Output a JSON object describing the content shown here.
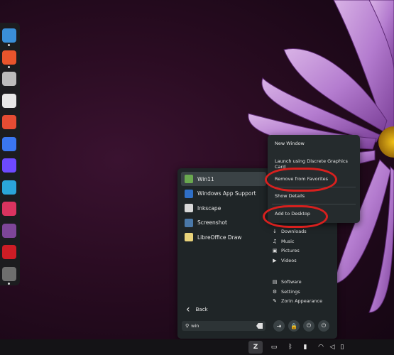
{
  "dock": {
    "items": [
      {
        "name": "files-icon",
        "color": "#3a8fd8"
      },
      {
        "name": "brave-icon",
        "color": "#e8552c"
      },
      {
        "name": "window-icon",
        "color": "#bcbcbc"
      },
      {
        "name": "calendar-icon",
        "color": "#e8e8e8"
      },
      {
        "name": "flathub-icon",
        "color": "#e44c33"
      },
      {
        "name": "signal-icon",
        "color": "#3a76f0"
      },
      {
        "name": "proton-vpn-icon",
        "color": "#6d4aff"
      },
      {
        "name": "win11-icon",
        "color": "#2aa6d8"
      },
      {
        "name": "vivaldi-icon",
        "color": "#d8345f"
      },
      {
        "name": "tor-icon",
        "color": "#7d4698"
      },
      {
        "name": "redhat-icon",
        "color": "#cc1d25"
      },
      {
        "name": "inkscape-icon",
        "color": "#6e6e6e"
      }
    ]
  },
  "menu": {
    "apps": [
      {
        "label": "Win11",
        "icon": "win11-icon",
        "color": "#6aa84f"
      },
      {
        "label": "Windows App Support",
        "icon": "wine-icon",
        "color": "#2f6fc6"
      },
      {
        "label": "Inkscape",
        "icon": "inkscape-icon",
        "color": "#d8d8d8"
      },
      {
        "label": "Screenshot",
        "icon": "screenshot-icon",
        "color": "#4a78a8"
      },
      {
        "label": "LibreOffice Draw",
        "icon": "libreoffice-draw-icon",
        "color": "#e8d27a"
      }
    ],
    "places": [
      {
        "label": "Downloads",
        "glyph": "↓"
      },
      {
        "label": "Music",
        "glyph": "♫"
      },
      {
        "label": "Pictures",
        "glyph": "▣"
      },
      {
        "label": "Videos",
        "glyph": "▶"
      }
    ],
    "system": [
      {
        "label": "Software",
        "glyph": "▤"
      },
      {
        "label": "Settings",
        "glyph": "⚙"
      },
      {
        "label": "Zorin Appearance",
        "glyph": "✎"
      }
    ],
    "back_label": "Back",
    "search_value": "win",
    "power_buttons": [
      {
        "name": "logout-button",
        "glyph": "⇥"
      },
      {
        "name": "lock-button",
        "glyph": "🔒"
      },
      {
        "name": "suspend-button",
        "glyph": "⏻"
      },
      {
        "name": "power-off-button",
        "glyph": "⏻"
      }
    ]
  },
  "context_menu": {
    "items": [
      "New Window",
      "Launch using Discrete Graphics Card",
      "Remove from Favorites",
      "Show Details",
      "Add to Desktop"
    ]
  },
  "taskbar": {
    "zorin_label": "Z",
    "tray": [
      "files-icon",
      "bluetooth-icon",
      "clipboard-icon",
      "wifi-icon",
      "volume-icon",
      "battery-icon"
    ]
  }
}
